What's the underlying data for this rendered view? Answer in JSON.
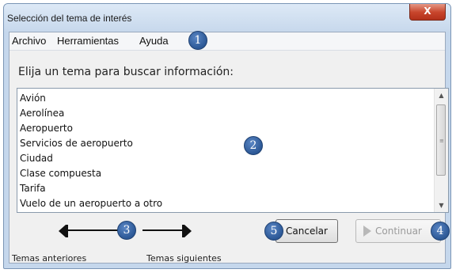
{
  "window": {
    "title": "Selección del tema de interés",
    "close_glyph": "X"
  },
  "menu": {
    "items": [
      "Archivo",
      "Herramientas",
      "Ayuda"
    ]
  },
  "prompt": "Elija un tema para buscar información:",
  "topics": [
    "Avión",
    "Aerolínea",
    "Aeropuerto",
    "Servicios de aeropuerto",
    "Ciudad",
    "Clase compuesta",
    "Tarifa",
    "Vuelo de un aeropuerto a otro"
  ],
  "navigation": {
    "previous_label": "Temas anteriores",
    "next_label": "Temas siguientes",
    "previous_icon": "arrow-left-icon",
    "next_icon": "arrow-right-icon"
  },
  "buttons": {
    "cancel": "Cancelar",
    "continue": "Continuar",
    "continue_enabled": false
  },
  "callouts": [
    "1",
    "2",
    "3",
    "4",
    "5"
  ],
  "colors": {
    "callout": "#2c5896",
    "close": "#c8452c"
  }
}
